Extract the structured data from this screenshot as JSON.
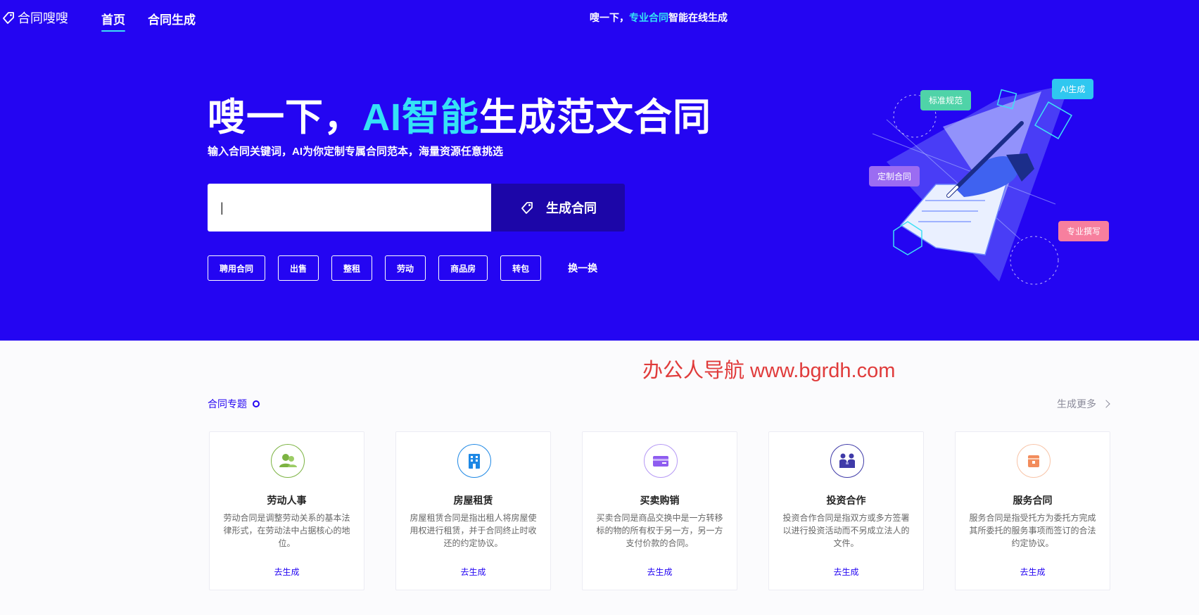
{
  "header": {
    "logo_text": "合同嗖嗖",
    "nav": [
      {
        "label": "首页",
        "active": true
      },
      {
        "label": "合同生成",
        "active": false
      }
    ],
    "slogan": {
      "part1": "嗖一下，",
      "highlight": "专业合同",
      "part2": "智能在线生成"
    }
  },
  "hero": {
    "title_part1": "嗖一下，",
    "title_highlight": "AI智能",
    "title_part2": "生成范文合同",
    "subtitle": "输入合同关键词，AI为你定制专属合同范本，海量资源任意挑选",
    "search": {
      "value": "|",
      "placeholder": ""
    },
    "generate_button": "生成合同",
    "tags": [
      "聘用合同",
      "出售",
      "整租",
      "劳动",
      "商品房",
      "转包"
    ],
    "refresh": "换一换",
    "illustration_bubbles": [
      "标准规范",
      "AI生成",
      "定制合同",
      "专业撰写"
    ]
  },
  "watermark": "办公人导航 www.bgrdh.com",
  "section": {
    "title": "合同专题",
    "more": "生成更多",
    "cards": [
      {
        "icon": "people-icon",
        "color": "#7cb342",
        "title": "劳动人事",
        "desc": "劳动合同是调整劳动关系的基本法律形式，在劳动法中占据核心的地位。",
        "link": "去生成"
      },
      {
        "icon": "building-icon",
        "color": "#1e88e5",
        "title": "房屋租赁",
        "desc": "房屋租赁合同是指出租人将房屋使用权进行租赁，并于合同终止时收还的约定协议。",
        "link": "去生成"
      },
      {
        "icon": "card-icon",
        "color": "#8e5cf0",
        "title": "买卖购销",
        "desc": "买卖合同是商品交换中是一方转移标的物的所有权于另一方，另一方支付价款的合同。",
        "link": "去生成"
      },
      {
        "icon": "handshake-icon",
        "color": "#3f3aa8",
        "title": "投资合作",
        "desc": "投资合作合同是指双方或多方签署以进行投资活动而不另成立法人的文件。",
        "link": "去生成"
      },
      {
        "icon": "package-icon",
        "color": "#f28c5c",
        "title": "服务合同",
        "desc": "服务合同是指受托方为委托方完成其所委托的服务事项而签订的合法约定协议。",
        "link": "去生成"
      }
    ]
  }
}
